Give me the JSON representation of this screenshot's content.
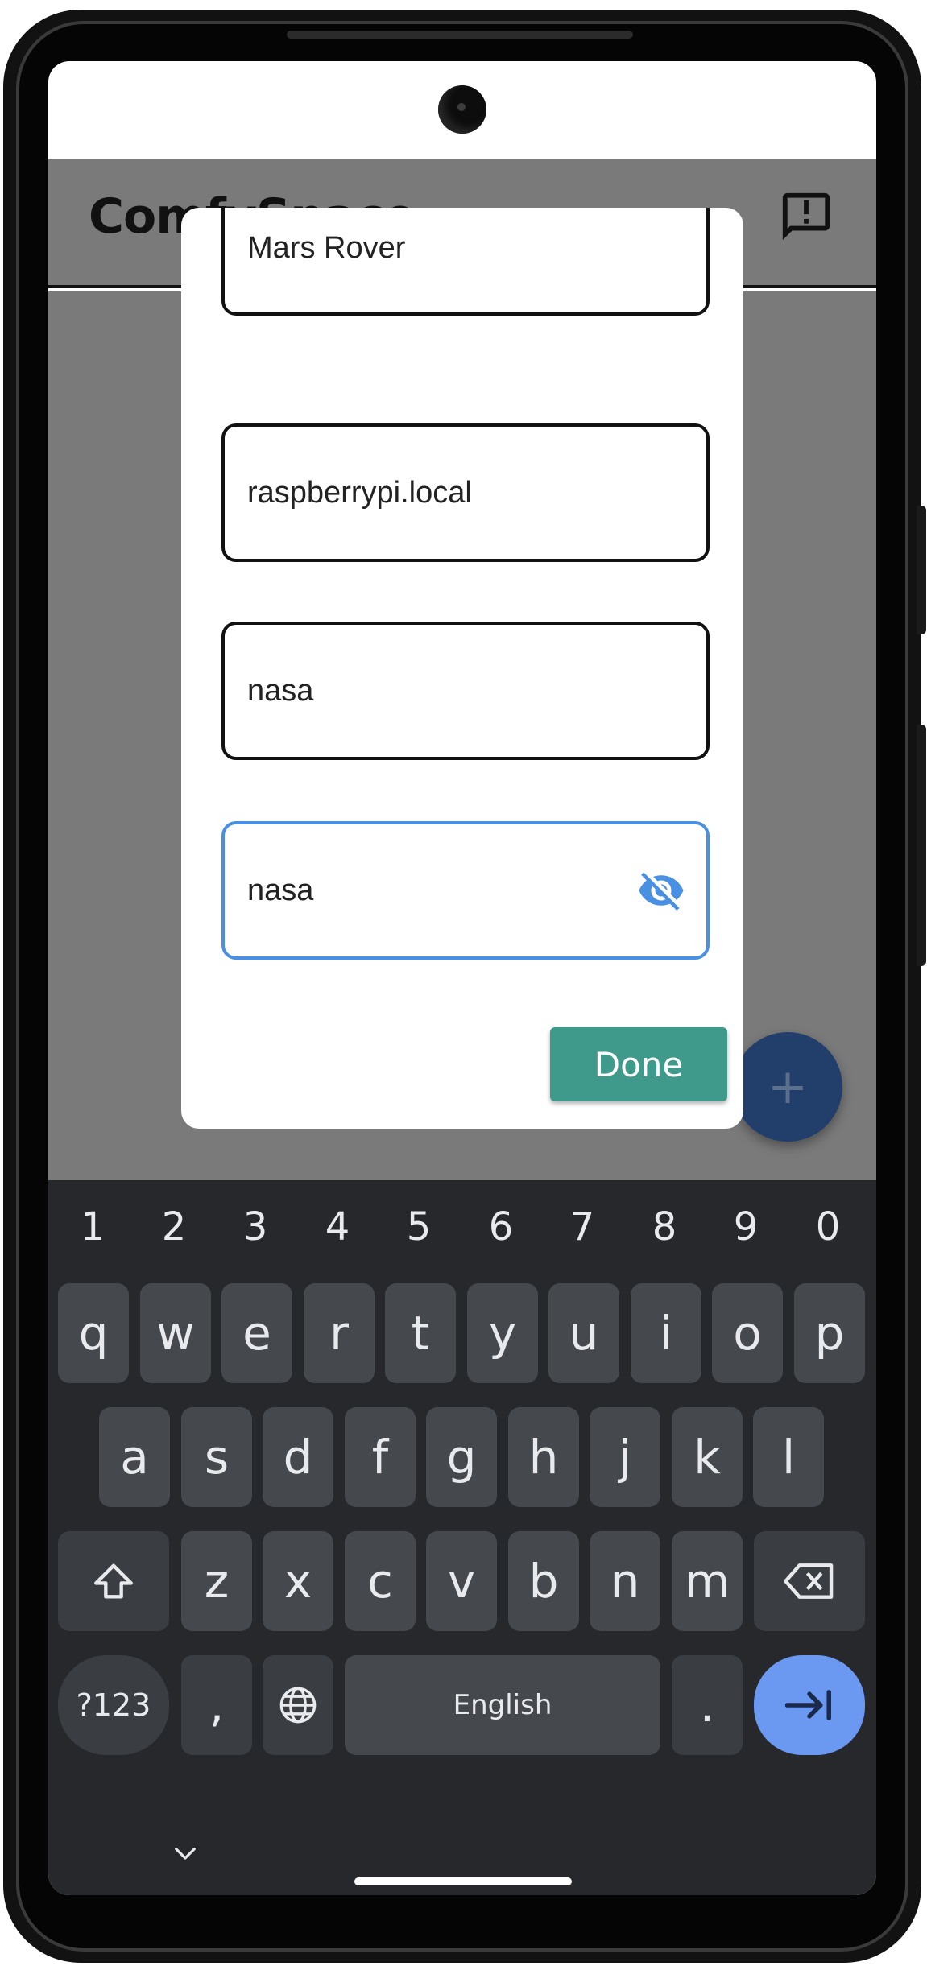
{
  "app": {
    "title": "ComfySpace",
    "feedback_icon": "feedback-icon",
    "fab_label": "+"
  },
  "dialog": {
    "fields": [
      {
        "name": "device-name",
        "value": "Mars Rover"
      },
      {
        "name": "hostname",
        "value": "raspberrypi.local"
      },
      {
        "name": "username",
        "value": "nasa"
      },
      {
        "name": "password",
        "value": "nasa"
      }
    ],
    "password_toggle_icon": "eye-off-icon",
    "done_label": "Done"
  },
  "keyboard": {
    "number_row": [
      "1",
      "2",
      "3",
      "4",
      "5",
      "6",
      "7",
      "8",
      "9",
      "0"
    ],
    "row1": [
      "q",
      "w",
      "e",
      "r",
      "t",
      "y",
      "u",
      "i",
      "o",
      "p"
    ],
    "row2": [
      "a",
      "s",
      "d",
      "f",
      "g",
      "h",
      "j",
      "k",
      "l"
    ],
    "row3": [
      "z",
      "x",
      "c",
      "v",
      "b",
      "n",
      "m"
    ],
    "numbers_label": "?123",
    "comma": ",",
    "space_label": "English",
    "period": ".",
    "shift_icon": "shift-icon",
    "backspace_icon": "backspace-icon",
    "globe_icon": "globe-icon",
    "enter_icon": "tab-next-icon",
    "collapse_icon": "chevron-down-icon"
  },
  "colors": {
    "accent_focus": "#4a90e2",
    "done_button": "#3f9a8b",
    "fab": "#223f6b",
    "enter_key": "#6b99f2",
    "keyboard_bg": "#26282c"
  }
}
